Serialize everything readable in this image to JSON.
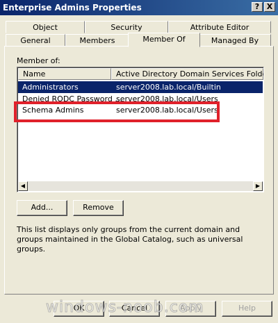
{
  "window": {
    "title": "Enterprise Admins Properties",
    "help_button": "?",
    "close_button": "X"
  },
  "tabs": {
    "back_row": [
      "Object",
      "Security",
      "Attribute Editor"
    ],
    "front_row": [
      "General",
      "Members",
      "Member Of",
      "Managed By"
    ],
    "active": "Member Of"
  },
  "member_of": {
    "label": "Member of:",
    "columns": [
      "Name",
      "Active Directory Domain Services Folder"
    ],
    "rows": [
      {
        "name": "Administrators",
        "folder": "server2008.lab.local/Builtin",
        "selected": true
      },
      {
        "name": "Denied RODC Password ...",
        "folder": "server2008.lab.local/Users",
        "selected": false
      },
      {
        "name": "Schema Admins",
        "folder": "server2008.lab.local/Users",
        "selected": false
      }
    ],
    "add_label": "Add...",
    "remove_label": "Remove",
    "info_text": "This list displays only groups from the current domain and groups maintained in the Global Catalog, such as universal groups."
  },
  "footer": {
    "ok_label": "OK",
    "cancel_label": "Cancel",
    "apply_label": "Apply",
    "help_label": "Help"
  },
  "watermark": "windows-noob.com",
  "colors": {
    "highlight_box": "#e0212b",
    "selection": "#0a246a",
    "titlebar": "#0a246a"
  }
}
